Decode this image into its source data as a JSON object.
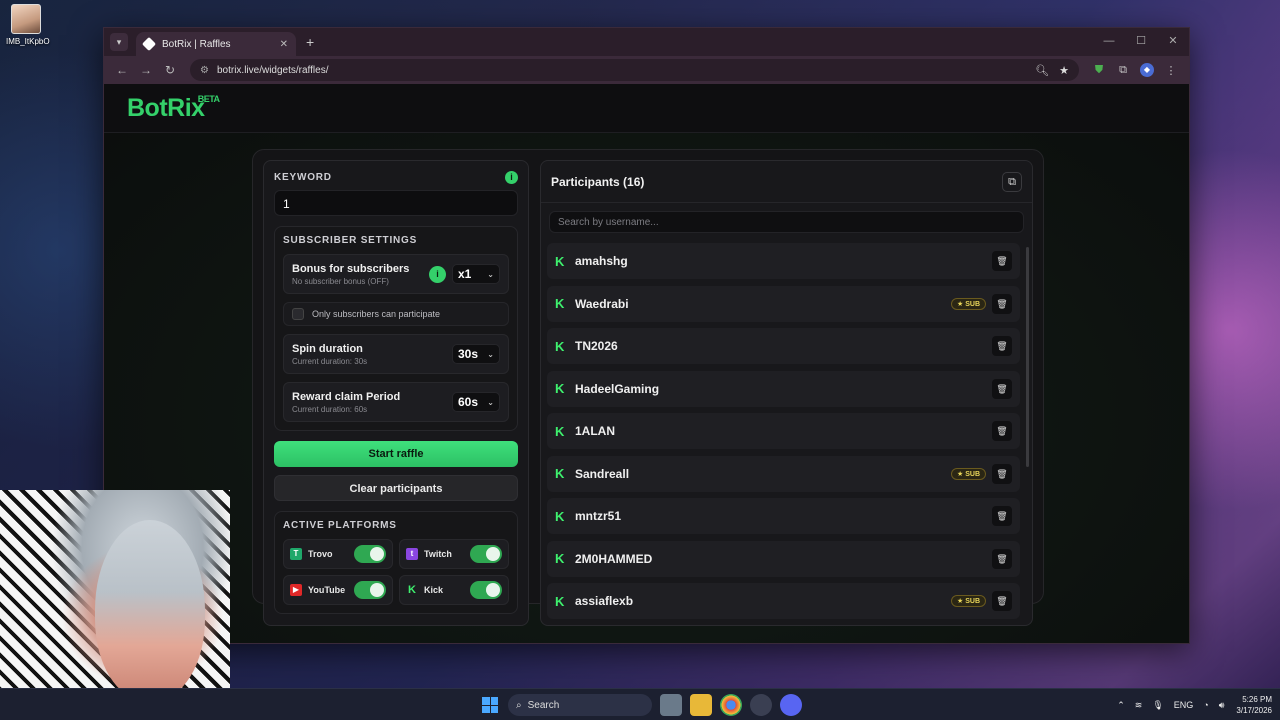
{
  "desktop": {
    "icon_label": "IMB_ItKpbO"
  },
  "browser": {
    "tab_title": "BotRix | Raffles",
    "url": "botrix.live/widgets/raffles/",
    "new_tab": "+",
    "tab_close": "✕",
    "window_controls": {
      "minimize": "—",
      "maximize": "☐",
      "close": "✕"
    },
    "nav": {
      "back": "←",
      "forward": "→",
      "reload": "↻"
    }
  },
  "site": {
    "logo": "BotRix",
    "logo_tag": "BETA"
  },
  "keyword": {
    "label": "KEYWORD",
    "info": "i",
    "value": "1"
  },
  "subscriber_settings": {
    "label": "SUBSCRIBER SETTINGS",
    "bonus": {
      "title": "Bonus for subscribers",
      "subtitle": "No subscriber bonus (OFF)",
      "info": "i",
      "value": "x1"
    },
    "only_subs": {
      "label": "Only subscribers can participate",
      "checked": false
    },
    "spin": {
      "title": "Spin duration",
      "subtitle": "Current duration: 30s",
      "value": "30s"
    },
    "claim": {
      "title": "Reward claim Period",
      "subtitle": "Current duration: 60s",
      "value": "60s"
    }
  },
  "buttons": {
    "start": "Start raffle",
    "clear": "Clear participants"
  },
  "platforms": {
    "label": "ACTIVE PLATFORMS",
    "items": [
      {
        "name": "Trovo",
        "enabled": true
      },
      {
        "name": "Twitch",
        "enabled": true
      },
      {
        "name": "YouTube",
        "enabled": true
      },
      {
        "name": "Kick",
        "enabled": true
      }
    ]
  },
  "participants": {
    "title": "Participants (16)",
    "search_placeholder": "Search by username...",
    "sub_badge": "★ SUB",
    "rows": [
      {
        "name": "amahshg",
        "sub": false
      },
      {
        "name": "Waedrabi",
        "sub": true
      },
      {
        "name": "TN2026",
        "sub": false
      },
      {
        "name": "HadeelGaming",
        "sub": false
      },
      {
        "name": "1ALAN",
        "sub": false
      },
      {
        "name": "Sandreall",
        "sub": true
      },
      {
        "name": "mntzr51",
        "sub": false
      },
      {
        "name": "2M0HAMMED",
        "sub": false
      },
      {
        "name": "assiaflexb",
        "sub": true
      }
    ]
  },
  "taskbar": {
    "search": "Search",
    "lang": "ENG",
    "time": "5:26 PM",
    "date": "3/17/2026"
  },
  "colors": {
    "accent": "#34d06a",
    "kick": "#3ef06e"
  }
}
